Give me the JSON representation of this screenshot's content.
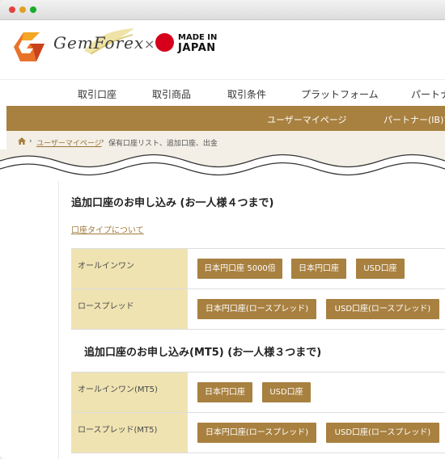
{
  "header": {
    "brand": "GemForex",
    "times": "×",
    "made_in": "MADE IN",
    "japan": "JAPAN"
  },
  "nav": {
    "items": [
      "取引口座",
      "取引商品",
      "取引条件",
      "プラットフォーム",
      "パートナ"
    ]
  },
  "subnav": {
    "items": [
      "ユーザーマイページ",
      "パートナー(IB)マ"
    ]
  },
  "breadcrumb": {
    "sep1": "›",
    "mypage": "ユーザーマイページ",
    "sep2": "›",
    "current": "保有口座リスト、追加口座、出金"
  },
  "section1": {
    "title": "追加口座のお申し込み (お一人様４つまで)",
    "about_link": "口座タイプについて",
    "rows": [
      {
        "label": "オールインワン",
        "buttons": [
          "日本円口座 5000倍",
          "日本円口座",
          "USD口座"
        ]
      },
      {
        "label": "ロースプレッド",
        "buttons": [
          "日本円口座(ロースプレッド)",
          "USD口座(ロースプレッド)"
        ]
      }
    ]
  },
  "section2": {
    "title": "追加口座のお申し込み(MT5) (お一人様３つまで)",
    "rows": [
      {
        "label": "オールインワン(MT5)",
        "buttons": [
          "日本円口座",
          "USD口座"
        ]
      },
      {
        "label": "ロースプレッド(MT5)",
        "buttons": [
          "日本円口座(ロースプレッド)",
          "USD口座(ロースプレッド)"
        ]
      }
    ]
  },
  "colors": {
    "gold": "#a8803f",
    "row_header": "#efe3b2",
    "breadcrumb_bg": "#f3efe6",
    "japan_red": "#d6001c"
  },
  "icons": [
    "home-icon",
    "gemforex-logo-icon",
    "japan-flag-icon"
  ]
}
